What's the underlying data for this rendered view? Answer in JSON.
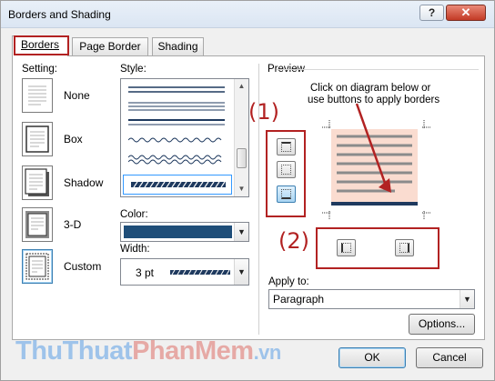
{
  "window": {
    "title": "Borders and Shading",
    "help_label": "?",
    "close_label": "✕"
  },
  "tabs": [
    {
      "label": "Borders",
      "active": true
    },
    {
      "label": "Page Border",
      "active": false
    },
    {
      "label": "Shading",
      "active": false
    }
  ],
  "setting": {
    "label": "Setting:",
    "items": [
      {
        "label": "None",
        "icon": "setting-none-icon"
      },
      {
        "label": "Box",
        "icon": "setting-box-icon"
      },
      {
        "label": "Shadow",
        "icon": "setting-shadow-icon"
      },
      {
        "label": "3-D",
        "icon": "setting-3d-icon"
      },
      {
        "label": "Custom",
        "icon": "setting-custom-icon"
      }
    ]
  },
  "style": {
    "label": "Style:"
  },
  "color": {
    "label": "Color:",
    "value_color": "#1f4e79"
  },
  "width": {
    "label": "Width:",
    "value": "3 pt"
  },
  "preview": {
    "label": "Preview",
    "instructions_line1": "Click on diagram below or",
    "instructions_line2": "use buttons to apply borders"
  },
  "annotations": {
    "marker1": "(1)",
    "marker2": "(2)",
    "color": "#b22222"
  },
  "apply_to": {
    "label": "Apply to:",
    "value": "Paragraph"
  },
  "buttons": {
    "options": "Options...",
    "ok": "OK",
    "cancel": "Cancel"
  },
  "watermark": {
    "part1": "ThuThuat",
    "part2": "PhanMem",
    "part3": ".vn"
  }
}
